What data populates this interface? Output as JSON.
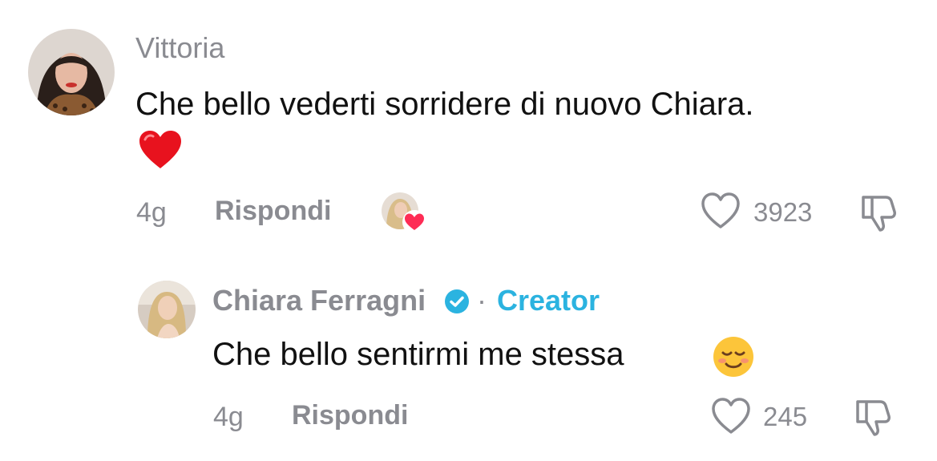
{
  "comment": {
    "author": "Vittoria",
    "text": "Che bello vederti sorridere di nuovo Chiara.",
    "age": "4g",
    "reply_label": "Rispondi",
    "likes": "3923",
    "reaction": "creator-liked-heart"
  },
  "reply": {
    "author": "Chiara Ferragni",
    "separator": "·",
    "badge_label": "Creator",
    "text": "Che bello sentirmi me stessa",
    "age": "4g",
    "reply_label": "Rispondi",
    "likes": "245"
  },
  "colors": {
    "accent": "#2bb3e0",
    "heart_red": "#fe2c55",
    "muted": "#8a8b91"
  }
}
